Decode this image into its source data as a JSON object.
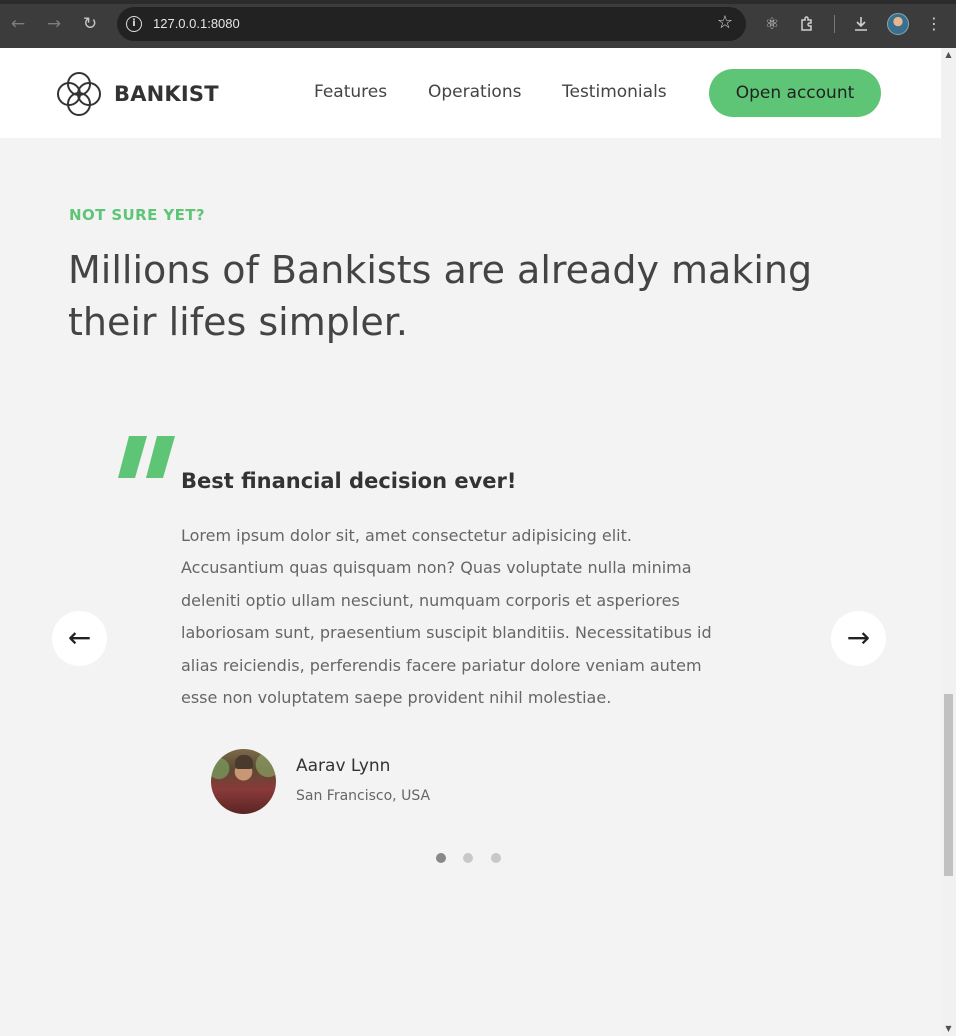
{
  "browser": {
    "url": "127.0.0.1:8080"
  },
  "header": {
    "brand": "BANKIST",
    "nav": [
      {
        "label": "Features"
      },
      {
        "label": "Operations"
      },
      {
        "label": "Testimonials"
      }
    ],
    "cta_label": "Open account"
  },
  "section": {
    "eyebrow": "NOT SURE YET?",
    "headline": "Millions of Bankists are already making their lifes simpler."
  },
  "testimonial": {
    "title": "Best financial decision ever!",
    "text": "Lorem ipsum dolor sit, amet consectetur adipisicing elit. Accusantium quas quisquam non? Quas voluptate nulla minima deleniti optio ullam nesciunt, numquam corporis et asperiores laboriosam sunt, praesentium suscipit blanditiis. Necessitatibus id alias reiciendis, perferendis facere pariatur dolore veniam autem esse non voluptatem saepe provident nihil molestiae.",
    "author_name": "Aarav Lynn",
    "author_location": "San Francisco, USA"
  },
  "slider": {
    "prev_symbol": "←",
    "next_symbol": "→",
    "slide_count": 3,
    "active_index": 0
  },
  "colors": {
    "accent": "#5ec576",
    "background": "#f3f3f3",
    "text": "#444444"
  },
  "icons": [
    "back-icon",
    "forward-icon",
    "reload-icon",
    "info-icon",
    "bookmark-star-icon",
    "react-devtools-icon",
    "extensions-icon",
    "download-icon",
    "profile-avatar",
    "menu-dots-icon",
    "bankist-logo-icon",
    "quote-icon",
    "arrow-left-icon",
    "arrow-right-icon"
  ]
}
